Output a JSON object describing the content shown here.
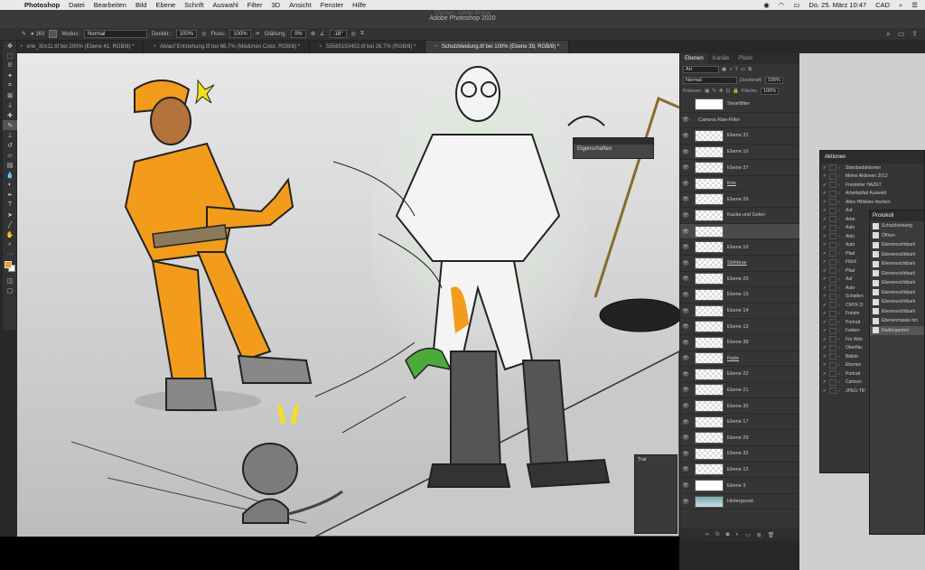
{
  "menubar": {
    "apple": "",
    "app": "Photoshop",
    "items": [
      "Datei",
      "Bearbeiten",
      "Bild",
      "Ebene",
      "Schrift",
      "Auswahl",
      "Filter",
      "3D",
      "Ansicht",
      "Fenster",
      "Hilfe"
    ],
    "date": "Do. 25. März 10:47",
    "user": "CAD"
  },
  "titlebar": {
    "title": "Adobe Photoshop 2020",
    "ghost": "Ebenen · Adobe Bridge"
  },
  "options": {
    "modus_label": "Modus:",
    "modus_value": "Normal",
    "deckkr_label": "Deckkr.:",
    "deckkr_value": "100%",
    "fluss_label": "Fluss:",
    "fluss_value": "100%",
    "glaettung_label": "Glättung:",
    "glaettung_value": "0%",
    "angle_value": "-18°",
    "brush_size": "163"
  },
  "tabs": [
    {
      "label": "erle_30x11.tif bei 200% (Ebene 41, RGB/8) *"
    },
    {
      "label": "Ablauf Entstehung.tif bei 66,7% (Mädchen Color, RGB/8) *"
    },
    {
      "label": "S5565150402.tif bei 26,7% (RGB/8) *"
    },
    {
      "label": "Schutzkleidung.tif bei 100% (Ebene 39, RGB/8) *"
    }
  ],
  "panels": {
    "layers_tab": "Ebenen",
    "channels_tab": "Kanäle",
    "paths_tab": "Pfade",
    "kind": "Art",
    "mode": "Normal",
    "opacity_label": "Deckkraft:",
    "opacity_value": "100%",
    "lock_label": "Fixieren:",
    "fill_label": "Fläche:",
    "fill_value": "100%"
  },
  "layers": [
    {
      "name": "Smartfilter",
      "thumb": "solid",
      "eye": ""
    },
    {
      "name": "Camera Raw-Filter",
      "thumb": "none",
      "eye": "👁"
    },
    {
      "name": "Ebene 31",
      "thumb": "check",
      "eye": "👁"
    },
    {
      "name": "Ebene 10",
      "thumb": "check",
      "eye": "👁"
    },
    {
      "name": "Ebene 37",
      "thumb": "check",
      "eye": "👁"
    },
    {
      "name": "linie",
      "thumb": "check",
      "eye": "👁",
      "underline": true
    },
    {
      "name": "Ebene 26",
      "thumb": "check",
      "eye": "👁"
    },
    {
      "name": "Kacka und Gelier",
      "thumb": "check",
      "eye": "👁"
    },
    {
      "name": "",
      "thumb": "check",
      "eye": "👁",
      "selected": true
    },
    {
      "name": "Ebene 16",
      "thumb": "check",
      "eye": "👁"
    },
    {
      "name": "Strikteue",
      "thumb": "check",
      "eye": "👁",
      "underline": true
    },
    {
      "name": "Ebene 20",
      "thumb": "check",
      "eye": "👁"
    },
    {
      "name": "Ebene 15",
      "thumb": "check",
      "eye": "👁"
    },
    {
      "name": "Ebene 14",
      "thumb": "check",
      "eye": "👁"
    },
    {
      "name": "Ebene 13",
      "thumb": "check",
      "eye": "👁"
    },
    {
      "name": "Ebene 38",
      "thumb": "check",
      "eye": "👁"
    },
    {
      "name": "Ratte",
      "thumb": "check",
      "eye": "👁",
      "underline": true
    },
    {
      "name": "Ebene 22",
      "thumb": "check",
      "eye": "👁"
    },
    {
      "name": "Ebene 21",
      "thumb": "check",
      "eye": "👁"
    },
    {
      "name": "Ebene 30",
      "thumb": "check",
      "eye": "👁"
    },
    {
      "name": "Ebene 17",
      "thumb": "check",
      "eye": "👁"
    },
    {
      "name": "Ebene 29",
      "thumb": "check",
      "eye": "👁"
    },
    {
      "name": "Ebene 32",
      "thumb": "check",
      "eye": "👁"
    },
    {
      "name": "Ebene 12",
      "thumb": "check",
      "eye": "👁"
    },
    {
      "name": "Ebene 3",
      "thumb": "solid",
      "eye": "👁"
    },
    {
      "name": "Hintergrund",
      "thumb": "img",
      "eye": "👁"
    }
  ],
  "eigenschaften": {
    "title": "Eigenschaften"
  },
  "aktionen": {
    "title": "Aktionen",
    "items": [
      "Standardaktionen",
      "Meine Aktionen 2012",
      "Freisteller HAZET",
      "Arbeitspfad Auswahl",
      "Altes Hilfslinie löschen",
      "Auf ",
      "Arbe",
      "Auto",
      "Aktu",
      "Auto",
      "Pfad",
      "Fläch",
      "Pfad",
      "Auf ",
      "Auto",
      "Schatten",
      "CMYK D",
      "Freiste",
      "Portrait",
      "Farben",
      "Für Web",
      "Oberfläc",
      "Bildeb",
      "Ebenen",
      "Portrait",
      "Cartoon",
      "JPEG-TIF"
    ]
  },
  "protokoll": {
    "title": "Protokoll",
    "items": [
      "Schutzkleidung",
      "Öffnen",
      "Ebenensichtbark",
      "Ebenensichtbark",
      "Ebenensichtbark",
      "Ebenensichtbark",
      "Ebenensichtbark",
      "Ebenensichtbark",
      "Ebenensichtbark",
      "Ebenensichtbark",
      "Ebenenmaske hin",
      "Radiergummi"
    ]
  },
  "trainer": {
    "title": "Trai"
  },
  "colors": {
    "foreground": "#f39c1c",
    "background": "#ffffff"
  }
}
